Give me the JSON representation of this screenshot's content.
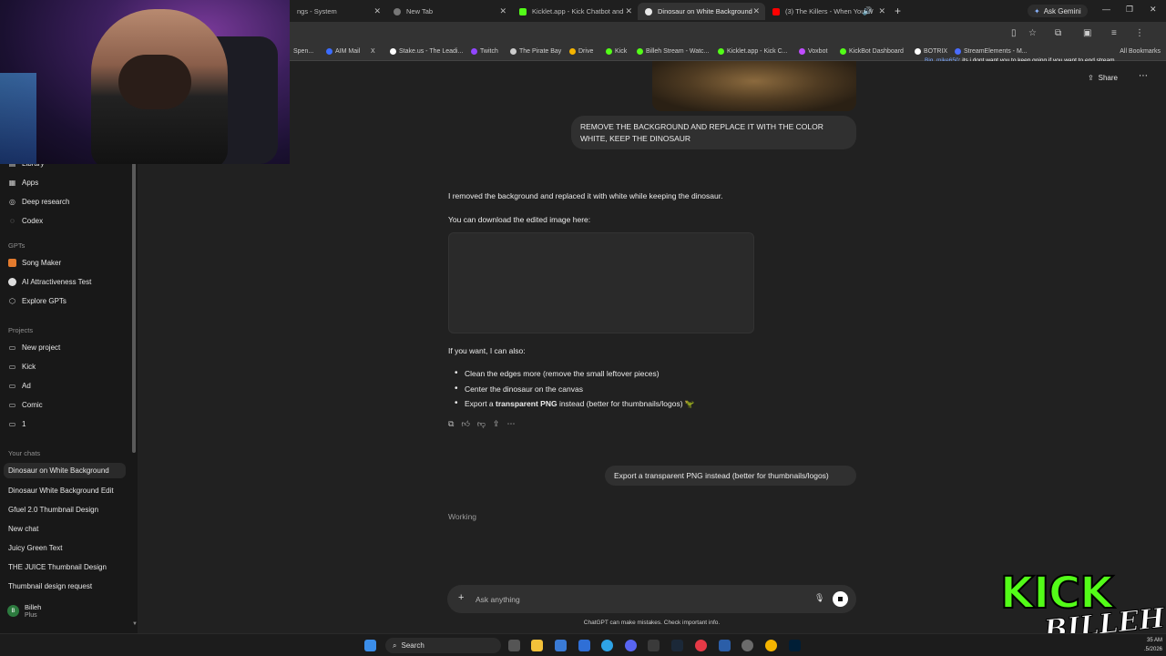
{
  "browser": {
    "tabs": [
      {
        "label": "ngs - System",
        "color": "#888888"
      },
      {
        "label": "New Tab",
        "color": "#888888"
      },
      {
        "label": "Kicklet.app - Kick Chatbot and",
        "color": "#53fc18"
      },
      {
        "label": "Dinosaur on White Background",
        "color": "#ffffff"
      },
      {
        "label": "(3) The Killers - When You W",
        "color": "#ff0000"
      }
    ],
    "ask_gemini": "Ask Gemini",
    "bookmarks": [
      {
        "label": "Spen...",
        "color": "#888888"
      },
      {
        "label": "AIM Mail",
        "color": "#3b6cff"
      },
      {
        "label": "X",
        "color": "#ffffff"
      },
      {
        "label": "Stake.us - The Leadi...",
        "color": "#ffffff"
      },
      {
        "label": "Twitch",
        "color": "#9146ff"
      },
      {
        "label": "The Pirate Bay",
        "color": "#cccccc"
      },
      {
        "label": "Drive",
        "color": "#f4b400"
      },
      {
        "label": "Kick",
        "color": "#53fc18"
      },
      {
        "label": "Billeh Stream - Watc...",
        "color": "#53fc18"
      },
      {
        "label": "Kicklet.app - Kick C...",
        "color": "#53fc18"
      },
      {
        "label": "Voxbot",
        "color": "#c04cff"
      },
      {
        "label": "KickBot Dashboard",
        "color": "#53fc18"
      },
      {
        "label": "BOTRIX",
        "color": "#ffffff"
      },
      {
        "label": "StreamElements - M...",
        "color": "#4a6cff"
      }
    ],
    "all_bookmarks": "All Bookmarks",
    "chat_overlay": {
      "user": "Big_mike650",
      "text": "its i dont want you to keep going if you want to end stream"
    }
  },
  "sidebar": {
    "top_items": [
      {
        "label": "Library",
        "icon": "library-icon"
      },
      {
        "label": "Apps",
        "icon": "apps-icon"
      },
      {
        "label": "Deep research",
        "icon": "telescope-icon"
      },
      {
        "label": "Codex",
        "icon": "code-icon"
      }
    ],
    "gpts_heading": "GPTs",
    "gpts": [
      {
        "label": "Song Maker",
        "icon": "song-icon"
      },
      {
        "label": "AI Attractiveness Test",
        "icon": "face-icon"
      },
      {
        "label": "Explore GPTs",
        "icon": "explore-icon"
      }
    ],
    "projects_heading": "Projects",
    "projects": [
      {
        "label": "New project",
        "icon": "folder-plus-icon"
      },
      {
        "label": "Kick",
        "icon": "folder-icon"
      },
      {
        "label": "Ad",
        "icon": "folder-icon"
      },
      {
        "label": "Comic",
        "icon": "folder-icon"
      },
      {
        "label": "1",
        "icon": "folder-icon"
      }
    ],
    "chats_heading": "Your chats",
    "chats": [
      "Dinosaur on White Background",
      "Dinosaur White Background Edit",
      "Gfuel 2.0 Thumbnail Design",
      "New chat",
      "Juicy Green Text",
      "THE JUICE Thumbnail Design",
      "Thumbnail design request"
    ],
    "user": {
      "name": "Billeh",
      "plan": "Plus",
      "initials": "B"
    }
  },
  "main": {
    "share_label": "Share",
    "user_message_1": "REMOVE THE BACKGROUND AND REPLACE IT WITH THE COLOR WHITE, KEEP THE DINOSAUR",
    "assistant_line_1": "I removed the background and replaced it with white while keeping the dinosaur.",
    "assistant_line_2": "You can download the edited image here:",
    "assistant_line_3": "If you want, I can also:",
    "bullets": [
      {
        "text": "Clean the edges more (remove the small leftover pieces)"
      },
      {
        "text": "Center the dinosaur on the canvas"
      },
      {
        "pre": "Export a ",
        "bold": "transparent PNG",
        "post": " instead (better for thumbnails/logos) 🦖"
      }
    ],
    "user_message_2": "Export a transparent PNG instead (better for thumbnails/logos)",
    "status": "Working",
    "composer_placeholder": "Ask anything",
    "disclaimer": "ChatGPT can make mistakes. Check important info."
  },
  "overlay": {
    "kick_text": "KICK",
    "name_text": "BILLEH"
  },
  "taskbar": {
    "search_label": "Search",
    "time": "35 AM",
    "date": ".5/2026"
  }
}
